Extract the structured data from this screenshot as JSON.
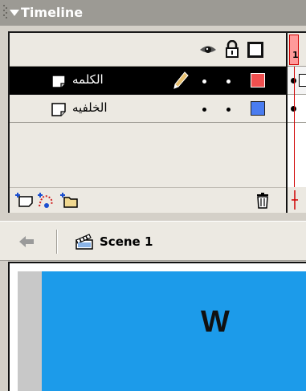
{
  "panel": {
    "title": "Timeline"
  },
  "layers": [
    {
      "name": "الكلمه",
      "selected": true,
      "color": "#f05050"
    },
    {
      "name": "الخلفيه",
      "selected": false,
      "color": "#4a7cf0"
    }
  ],
  "frames": {
    "current_frame": "1"
  },
  "scene": {
    "label": "Scene 1"
  },
  "stage": {
    "text": "W",
    "background_color": "#1c9bea"
  }
}
